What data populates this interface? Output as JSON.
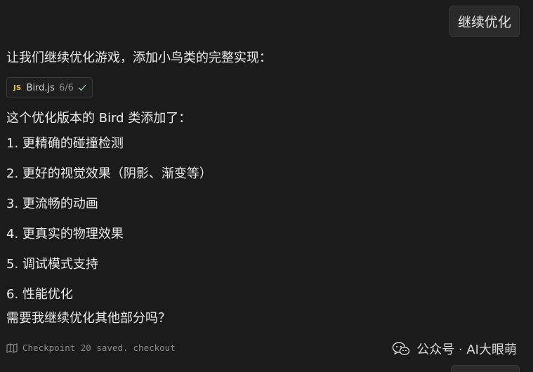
{
  "user_message": {
    "text": "继续优化"
  },
  "assistant": {
    "intro": "让我们继续优化游戏，添加小鸟类的完整实现：",
    "file_chip": {
      "icon": "JS",
      "filename": "Bird.js",
      "progress": "6/6",
      "status_icon": "check-icon"
    },
    "summary_heading": "这个优化版本的 Bird 类添加了：",
    "features": [
      {
        "text": "1. 更精确的碰撞检测"
      },
      {
        "text": "2. 更好的视觉效果（阴影、渐变等）"
      },
      {
        "text": "3. 更流畅的动画"
      },
      {
        "text": "4. 更真实的物理效果"
      },
      {
        "text": "5. 调试模式支持"
      },
      {
        "text": "6. 性能优化"
      }
    ],
    "question": "需要我继续优化其他部分吗？"
  },
  "checkpoint": {
    "text": "Checkpoint 20 saved.",
    "link": "checkout"
  },
  "watermark": {
    "text": "公众号 · AI大眼萌"
  },
  "colors": {
    "background": "#1b1b1b",
    "text": "#ebebeb",
    "muted": "#8a8a8a",
    "js_badge": "#e6c84f",
    "check": "#9fd4a8"
  }
}
